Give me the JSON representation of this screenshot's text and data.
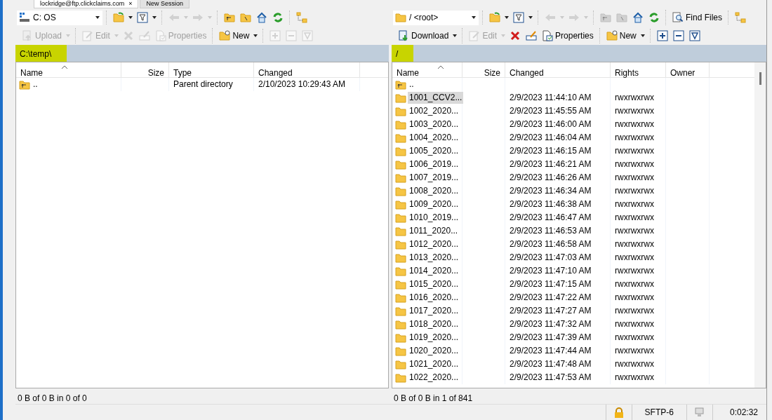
{
  "session_tabs": [
    {
      "label": "lockridge@ftp.clickclaims.com",
      "selected": true,
      "close": "×"
    },
    {
      "label": "New Session",
      "selected": false
    }
  ],
  "panels": [
    {
      "combo": {
        "kind": "drive",
        "value": "C: OS"
      },
      "toolbar_1": [
        [
          {
            "kind": "open-folder",
            "disabled": false,
            "dropdown": true
          },
          {
            "kind": "filter",
            "disabled": false,
            "dropdown": true
          }
        ],
        [
          {
            "kind": "back",
            "disabled": true,
            "dropdown": true
          },
          {
            "kind": "forward",
            "disabled": true,
            "dropdown": true
          }
        ],
        [
          {
            "kind": "parent",
            "disabled": false,
            "dropdown": false
          },
          {
            "kind": "root",
            "disabled": false,
            "dropdown": false
          },
          {
            "kind": "home",
            "disabled": false,
            "dropdown": false
          },
          {
            "kind": "refresh",
            "disabled": false,
            "dropdown": false
          }
        ],
        [
          {
            "kind": "tree",
            "disabled": false,
            "dropdown": false
          }
        ]
      ],
      "toolbar_2": [
        [
          {
            "kind": "upload",
            "label": "Upload",
            "disabled": true,
            "dropdown": true
          }
        ],
        [
          {
            "kind": "edit",
            "label": "Edit",
            "disabled": true,
            "dropdown": true
          },
          {
            "kind": "delete",
            "disabled": true,
            "dropdown": false
          },
          {
            "kind": "rename",
            "disabled": true,
            "dropdown": false
          },
          {
            "kind": "properties",
            "label": "Properties",
            "disabled": true,
            "dropdown": false
          }
        ],
        [
          {
            "kind": "new",
            "label": "New",
            "disabled": false,
            "dropdown": true
          }
        ],
        [
          {
            "kind": "select-plus",
            "disabled": true,
            "dropdown": false
          },
          {
            "kind": "select-minus",
            "disabled": true,
            "dropdown": false
          },
          {
            "kind": "select-filter",
            "disabled": true,
            "dropdown": false
          }
        ]
      ],
      "path": "C:\\temp\\",
      "path_highlighted": true,
      "columns": [
        "Name",
        "Size",
        "Type",
        "Changed"
      ],
      "rows": [
        {
          "kind": "parent",
          "selected": false,
          "cells": [
            "..",
            "",
            "Parent directory",
            "2/10/2023  10:29:43 AM"
          ]
        }
      ],
      "status": "0 B of 0 B in 0 of 0"
    },
    {
      "combo": {
        "kind": "folder",
        "value": "/ <root>"
      },
      "toolbar_1": [
        [
          {
            "kind": "open-folder",
            "disabled": false,
            "dropdown": true
          },
          {
            "kind": "filter",
            "disabled": false,
            "dropdown": true
          }
        ],
        [
          {
            "kind": "back",
            "disabled": true,
            "dropdown": true
          },
          {
            "kind": "forward",
            "disabled": true,
            "dropdown": true
          }
        ],
        [
          {
            "kind": "parent",
            "disabled": true,
            "dropdown": false
          },
          {
            "kind": "root",
            "disabled": true,
            "dropdown": false
          },
          {
            "kind": "home",
            "disabled": false,
            "dropdown": false
          },
          {
            "kind": "refresh",
            "disabled": false,
            "dropdown": false
          }
        ],
        [
          {
            "kind": "find",
            "label": "Find Files",
            "disabled": false,
            "dropdown": false
          }
        ],
        [
          {
            "kind": "tree",
            "disabled": false,
            "dropdown": false
          }
        ]
      ],
      "toolbar_2": [
        [
          {
            "kind": "download",
            "label": "Download",
            "disabled": false,
            "dropdown": true
          }
        ],
        [
          {
            "kind": "edit",
            "label": "Edit",
            "disabled": true,
            "dropdown": true
          },
          {
            "kind": "delete",
            "disabled": false,
            "dropdown": false
          },
          {
            "kind": "rename",
            "disabled": false,
            "dropdown": false
          },
          {
            "kind": "properties",
            "label": "Properties",
            "disabled": false,
            "dropdown": false
          }
        ],
        [
          {
            "kind": "new",
            "label": "New",
            "disabled": false,
            "dropdown": true
          }
        ],
        [
          {
            "kind": "select-plus",
            "disabled": false,
            "dropdown": false
          },
          {
            "kind": "select-minus",
            "disabled": false,
            "dropdown": false
          },
          {
            "kind": "select-filter",
            "disabled": false,
            "dropdown": false
          }
        ]
      ],
      "path": "/",
      "path_highlighted": true,
      "columns": [
        "Name",
        "Size",
        "Changed",
        "Rights",
        "Owner"
      ],
      "rows": [
        {
          "kind": "parent",
          "selected": false,
          "cells": [
            "..",
            "",
            "",
            "",
            ""
          ]
        },
        {
          "kind": "folder",
          "selected": true,
          "cells": [
            "1001_CCV2...",
            "",
            "2/9/2023 11:44:10 AM",
            "rwxrwxrwx",
            ""
          ]
        },
        {
          "kind": "folder",
          "selected": false,
          "cells": [
            "1002_2020...",
            "",
            "2/9/2023 11:45:55 AM",
            "rwxrwxrwx",
            ""
          ]
        },
        {
          "kind": "folder",
          "selected": false,
          "cells": [
            "1003_2020...",
            "",
            "2/9/2023 11:46:00 AM",
            "rwxrwxrwx",
            ""
          ]
        },
        {
          "kind": "folder",
          "selected": false,
          "cells": [
            "1004_2020...",
            "",
            "2/9/2023 11:46:04 AM",
            "rwxrwxrwx",
            ""
          ]
        },
        {
          "kind": "folder",
          "selected": false,
          "cells": [
            "1005_2020...",
            "",
            "2/9/2023 11:46:15 AM",
            "rwxrwxrwx",
            ""
          ]
        },
        {
          "kind": "folder",
          "selected": false,
          "cells": [
            "1006_2019...",
            "",
            "2/9/2023 11:46:21 AM",
            "rwxrwxrwx",
            ""
          ]
        },
        {
          "kind": "folder",
          "selected": false,
          "cells": [
            "1007_2019...",
            "",
            "2/9/2023 11:46:26 AM",
            "rwxrwxrwx",
            ""
          ]
        },
        {
          "kind": "folder",
          "selected": false,
          "cells": [
            "1008_2020...",
            "",
            "2/9/2023 11:46:34 AM",
            "rwxrwxrwx",
            ""
          ]
        },
        {
          "kind": "folder",
          "selected": false,
          "cells": [
            "1009_2020...",
            "",
            "2/9/2023 11:46:38 AM",
            "rwxrwxrwx",
            ""
          ]
        },
        {
          "kind": "folder",
          "selected": false,
          "cells": [
            "1010_2019...",
            "",
            "2/9/2023 11:46:47 AM",
            "rwxrwxrwx",
            ""
          ]
        },
        {
          "kind": "folder",
          "selected": false,
          "cells": [
            "1011_2020...",
            "",
            "2/9/2023 11:46:53 AM",
            "rwxrwxrwx",
            ""
          ]
        },
        {
          "kind": "folder",
          "selected": false,
          "cells": [
            "1012_2020...",
            "",
            "2/9/2023 11:46:58 AM",
            "rwxrwxrwx",
            ""
          ]
        },
        {
          "kind": "folder",
          "selected": false,
          "cells": [
            "1013_2020...",
            "",
            "2/9/2023 11:47:03 AM",
            "rwxrwxrwx",
            ""
          ]
        },
        {
          "kind": "folder",
          "selected": false,
          "cells": [
            "1014_2020...",
            "",
            "2/9/2023 11:47:10 AM",
            "rwxrwxrwx",
            ""
          ]
        },
        {
          "kind": "folder",
          "selected": false,
          "cells": [
            "1015_2020...",
            "",
            "2/9/2023 11:47:15 AM",
            "rwxrwxrwx",
            ""
          ]
        },
        {
          "kind": "folder",
          "selected": false,
          "cells": [
            "1016_2020...",
            "",
            "2/9/2023 11:47:22 AM",
            "rwxrwxrwx",
            ""
          ]
        },
        {
          "kind": "folder",
          "selected": false,
          "cells": [
            "1017_2020...",
            "",
            "2/9/2023 11:47:27 AM",
            "rwxrwxrwx",
            ""
          ]
        },
        {
          "kind": "folder",
          "selected": false,
          "cells": [
            "1018_2020...",
            "",
            "2/9/2023 11:47:32 AM",
            "rwxrwxrwx",
            ""
          ]
        },
        {
          "kind": "folder",
          "selected": false,
          "cells": [
            "1019_2020...",
            "",
            "2/9/2023 11:47:39 AM",
            "rwxrwxrwx",
            ""
          ]
        },
        {
          "kind": "folder",
          "selected": false,
          "cells": [
            "1020_2020...",
            "",
            "2/9/2023 11:47:44 AM",
            "rwxrwxrwx",
            ""
          ]
        },
        {
          "kind": "folder",
          "selected": false,
          "cells": [
            "1021_2020...",
            "",
            "2/9/2023 11:47:48 AM",
            "rwxrwxrwx",
            ""
          ]
        },
        {
          "kind": "folder",
          "selected": false,
          "cells": [
            "1022_2020...",
            "",
            "2/9/2023 11:47:53 AM",
            "rwxrwxrwx",
            ""
          ]
        }
      ],
      "status": "0 B of 0 B in 1 of 841"
    }
  ],
  "status_bar": {
    "locked": true,
    "protocol": "SFTP-6",
    "elapsed": "0:02:32"
  }
}
